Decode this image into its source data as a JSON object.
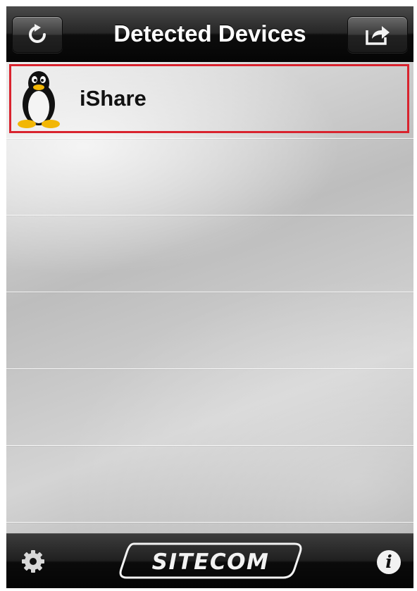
{
  "navbar": {
    "title": "Detected Devices",
    "left_icon": "refresh-icon",
    "right_icon": "share-icon"
  },
  "devices": [
    {
      "label": "iShare",
      "icon": "linux-penguin-icon",
      "selected": true
    }
  ],
  "toolbar": {
    "left_icon": "gear-icon",
    "logo_text": "SITECOM",
    "right_icon": "info-icon",
    "info_glyph": "i"
  },
  "colors": {
    "selection_border": "#d9232e",
    "bar_background": "#0c0c0c",
    "title_text": "#ffffff"
  }
}
